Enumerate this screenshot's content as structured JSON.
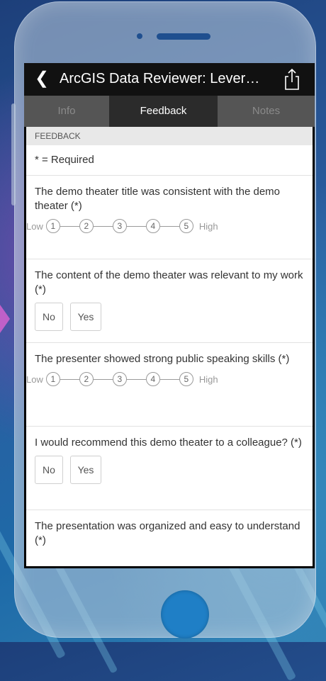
{
  "colors": {
    "navbar": "#111111",
    "tab_bar": "#555555",
    "active_tab": "#2b2b2b",
    "home_button": "#1f7fc6"
  },
  "app": {
    "title": "ArcGIS Data Reviewer: Lever…"
  },
  "icons": {
    "back": "chevron-left-icon",
    "share": "share-icon"
  },
  "tabs": [
    {
      "label": "Info",
      "active": false
    },
    {
      "label": "Feedback",
      "active": true
    },
    {
      "label": "Notes",
      "active": false
    }
  ],
  "section": {
    "header": "FEEDBACK",
    "required_note": "* = Required"
  },
  "scale": {
    "low": "Low",
    "high": "High",
    "points": [
      "1",
      "2",
      "3",
      "4",
      "5"
    ]
  },
  "yesno": {
    "no": "No",
    "yes": "Yes"
  },
  "questions": [
    {
      "text": "The demo theater title was consistent with the demo theater (*)",
      "type": "rating"
    },
    {
      "text": "The content of the demo theater was relevant to my work (*)",
      "type": "yesno"
    },
    {
      "text": "The presenter showed strong public speaking skills (*)",
      "type": "rating"
    },
    {
      "text": "I would recommend this demo theater to a colleague? (*)",
      "type": "yesno"
    },
    {
      "text": "The presentation was organized and easy to understand  (*)",
      "type": "rating"
    }
  ]
}
